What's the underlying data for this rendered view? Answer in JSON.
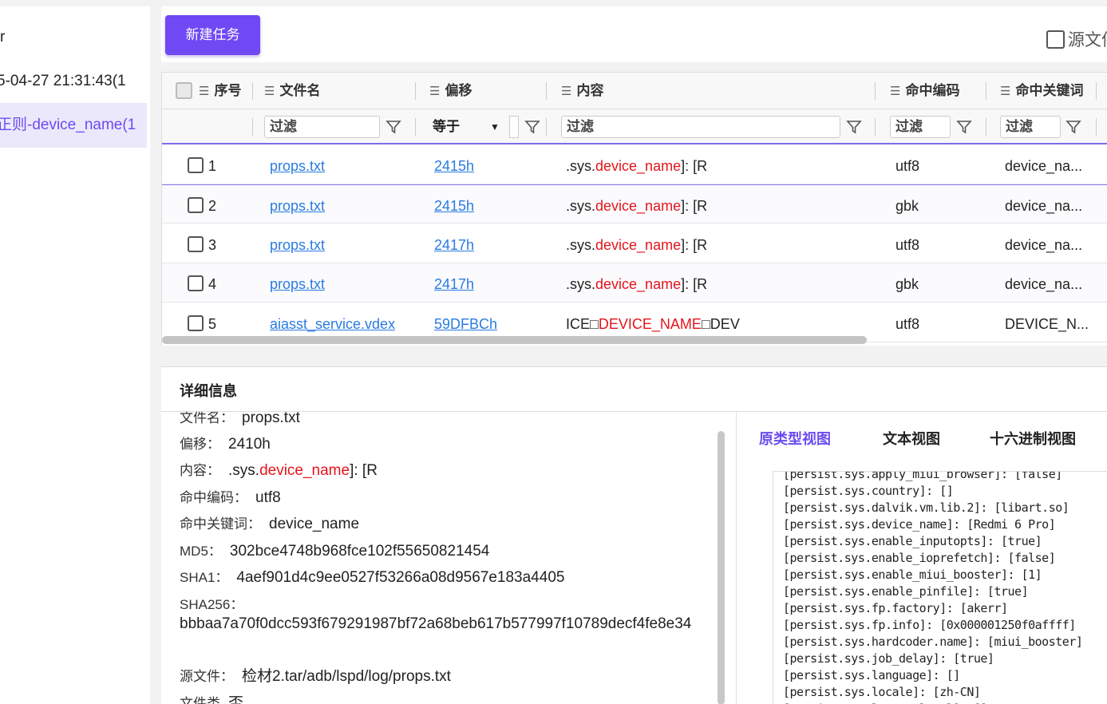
{
  "sidebar": {
    "items": [
      {
        "label": "r"
      },
      {
        "label": "5-04-27 21:31:43(1"
      },
      {
        "label": "正则-device_name(1"
      }
    ]
  },
  "toolbar": {
    "new_task_label": "新建任务",
    "source_checkbox_label": "源文件"
  },
  "grid": {
    "columns": {
      "index": "序号",
      "filename": "文件名",
      "offset": "偏移",
      "content": "内容",
      "encoding": "命中编码",
      "keyword": "命中关键词"
    },
    "filter_placeholder": "过滤",
    "offset_filter_op": "等于",
    "rows": [
      {
        "index": "1",
        "filename": "props.txt",
        "offset": "2415h",
        "content_pre": ".sys.",
        "content_hit": "device_name",
        "content_post": "]: [R",
        "encoding": "utf8",
        "keyword": "device_na..."
      },
      {
        "index": "2",
        "filename": "props.txt",
        "offset": "2415h",
        "content_pre": ".sys.",
        "content_hit": "device_name",
        "content_post": "]: [R",
        "encoding": "gbk",
        "keyword": "device_na..."
      },
      {
        "index": "3",
        "filename": "props.txt",
        "offset": "2417h",
        "content_pre": ".sys.",
        "content_hit": "device_name",
        "content_post": "]: [R",
        "encoding": "utf8",
        "keyword": "device_na..."
      },
      {
        "index": "4",
        "filename": "props.txt",
        "offset": "2417h",
        "content_pre": ".sys.",
        "content_hit": "device_name",
        "content_post": "]: [R",
        "encoding": "gbk",
        "keyword": "device_na..."
      },
      {
        "index": "5",
        "filename": "aiasst_service.vdex",
        "offset": "59DFBCh",
        "content_pre": "ICE□",
        "content_hit": "DEVICE_NAME",
        "content_post": "□DEV",
        "encoding": "utf8",
        "keyword": "DEVICE_N..."
      }
    ]
  },
  "details": {
    "title": "详细信息",
    "filename_label": "文件名：",
    "filename_value": "props.txt",
    "offset_label": "偏移：",
    "offset_value": "2410h",
    "content_label": "内容：",
    "content_pre": ".sys.",
    "content_hit": "device_name",
    "content_post": "]: [R",
    "encoding_label": "命中编码：",
    "encoding_value": "utf8",
    "keyword_label": "命中关键词：",
    "keyword_value": "device_name",
    "md5_label": "MD5：",
    "md5_value": "302bce4748b968fce102f55650821454",
    "sha1_label": "SHA1：",
    "sha1_value": "4aef901d4c9ee0527f53266a08d9567e183a4405",
    "sha256_label": "SHA256：",
    "sha256_value": "bbbaa7a70f0dcc593f679291987bf72a68beb617b577997f10789decf4fe8e34",
    "source_label": "源文件：",
    "source_value": "检材2.tar/adb/lspd/log/props.txt",
    "extra_label": "文件类",
    "extra_value": "否"
  },
  "view_tabs": {
    "prototype": "原类型视图",
    "text": "文本视图",
    "hex": "十六进制视图"
  },
  "raw_lines": [
    "[persist.sys.apply_miui_browser]: [false]",
    "[persist.sys.country]: []",
    "[persist.sys.dalvik.vm.lib.2]: [libart.so]",
    "[persist.sys.device_name]: [Redmi 6 Pro]",
    "[persist.sys.enable_inputopts]: [true]",
    "[persist.sys.enable_ioprefetch]: [false]",
    "[persist.sys.enable_miui_booster]: [1]",
    "[persist.sys.enable_pinfile]: [true]",
    "[persist.sys.fp.factory]: [akerr]",
    "[persist.sys.fp.info]: [0x000001250f0affff]",
    "[persist.sys.hardcoder.name]: [miui_booster]",
    "[persist.sys.job_delay]: [true]",
    "[persist.sys.language]: []",
    "[persist.sys.locale]: [zh-CN]",
    "[persist.sys.logcat_level]: []"
  ]
}
